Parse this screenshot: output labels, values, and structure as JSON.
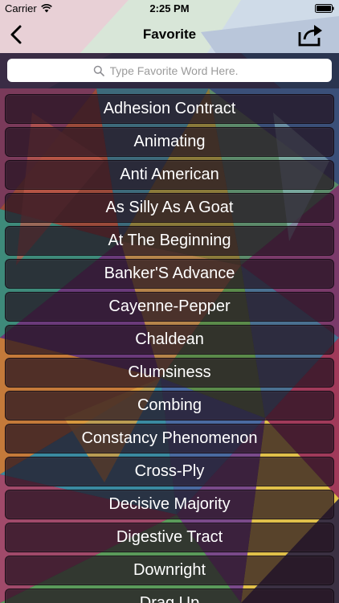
{
  "status_bar": {
    "carrier": "Carrier",
    "time": "2:25 PM",
    "icons": [
      "wifi-icon",
      "battery-icon"
    ]
  },
  "nav": {
    "title": "Favorite",
    "back_icon": "chevron-left-icon",
    "share_icon": "share-icon"
  },
  "search": {
    "placeholder": "Type Favorite Word Here.",
    "value": "",
    "icon": "search-icon"
  },
  "words": [
    "Adhesion Contract",
    "Animating",
    "Anti American",
    "As Silly As A Goat",
    "At The Beginning",
    "Banker'S Advance",
    "Cayenne-Pepper",
    "Chaldean",
    "Clumsiness",
    "Combing",
    "Constancy Phenomenon",
    "Cross-Ply",
    "Decisive Majority",
    "Digestive Tract",
    "Downright",
    "Drag Up"
  ],
  "colors": {
    "row_background": "#231220",
    "row_text": "#ffffff",
    "search_background": "#ffffff",
    "placeholder": "#9b9b9b"
  }
}
